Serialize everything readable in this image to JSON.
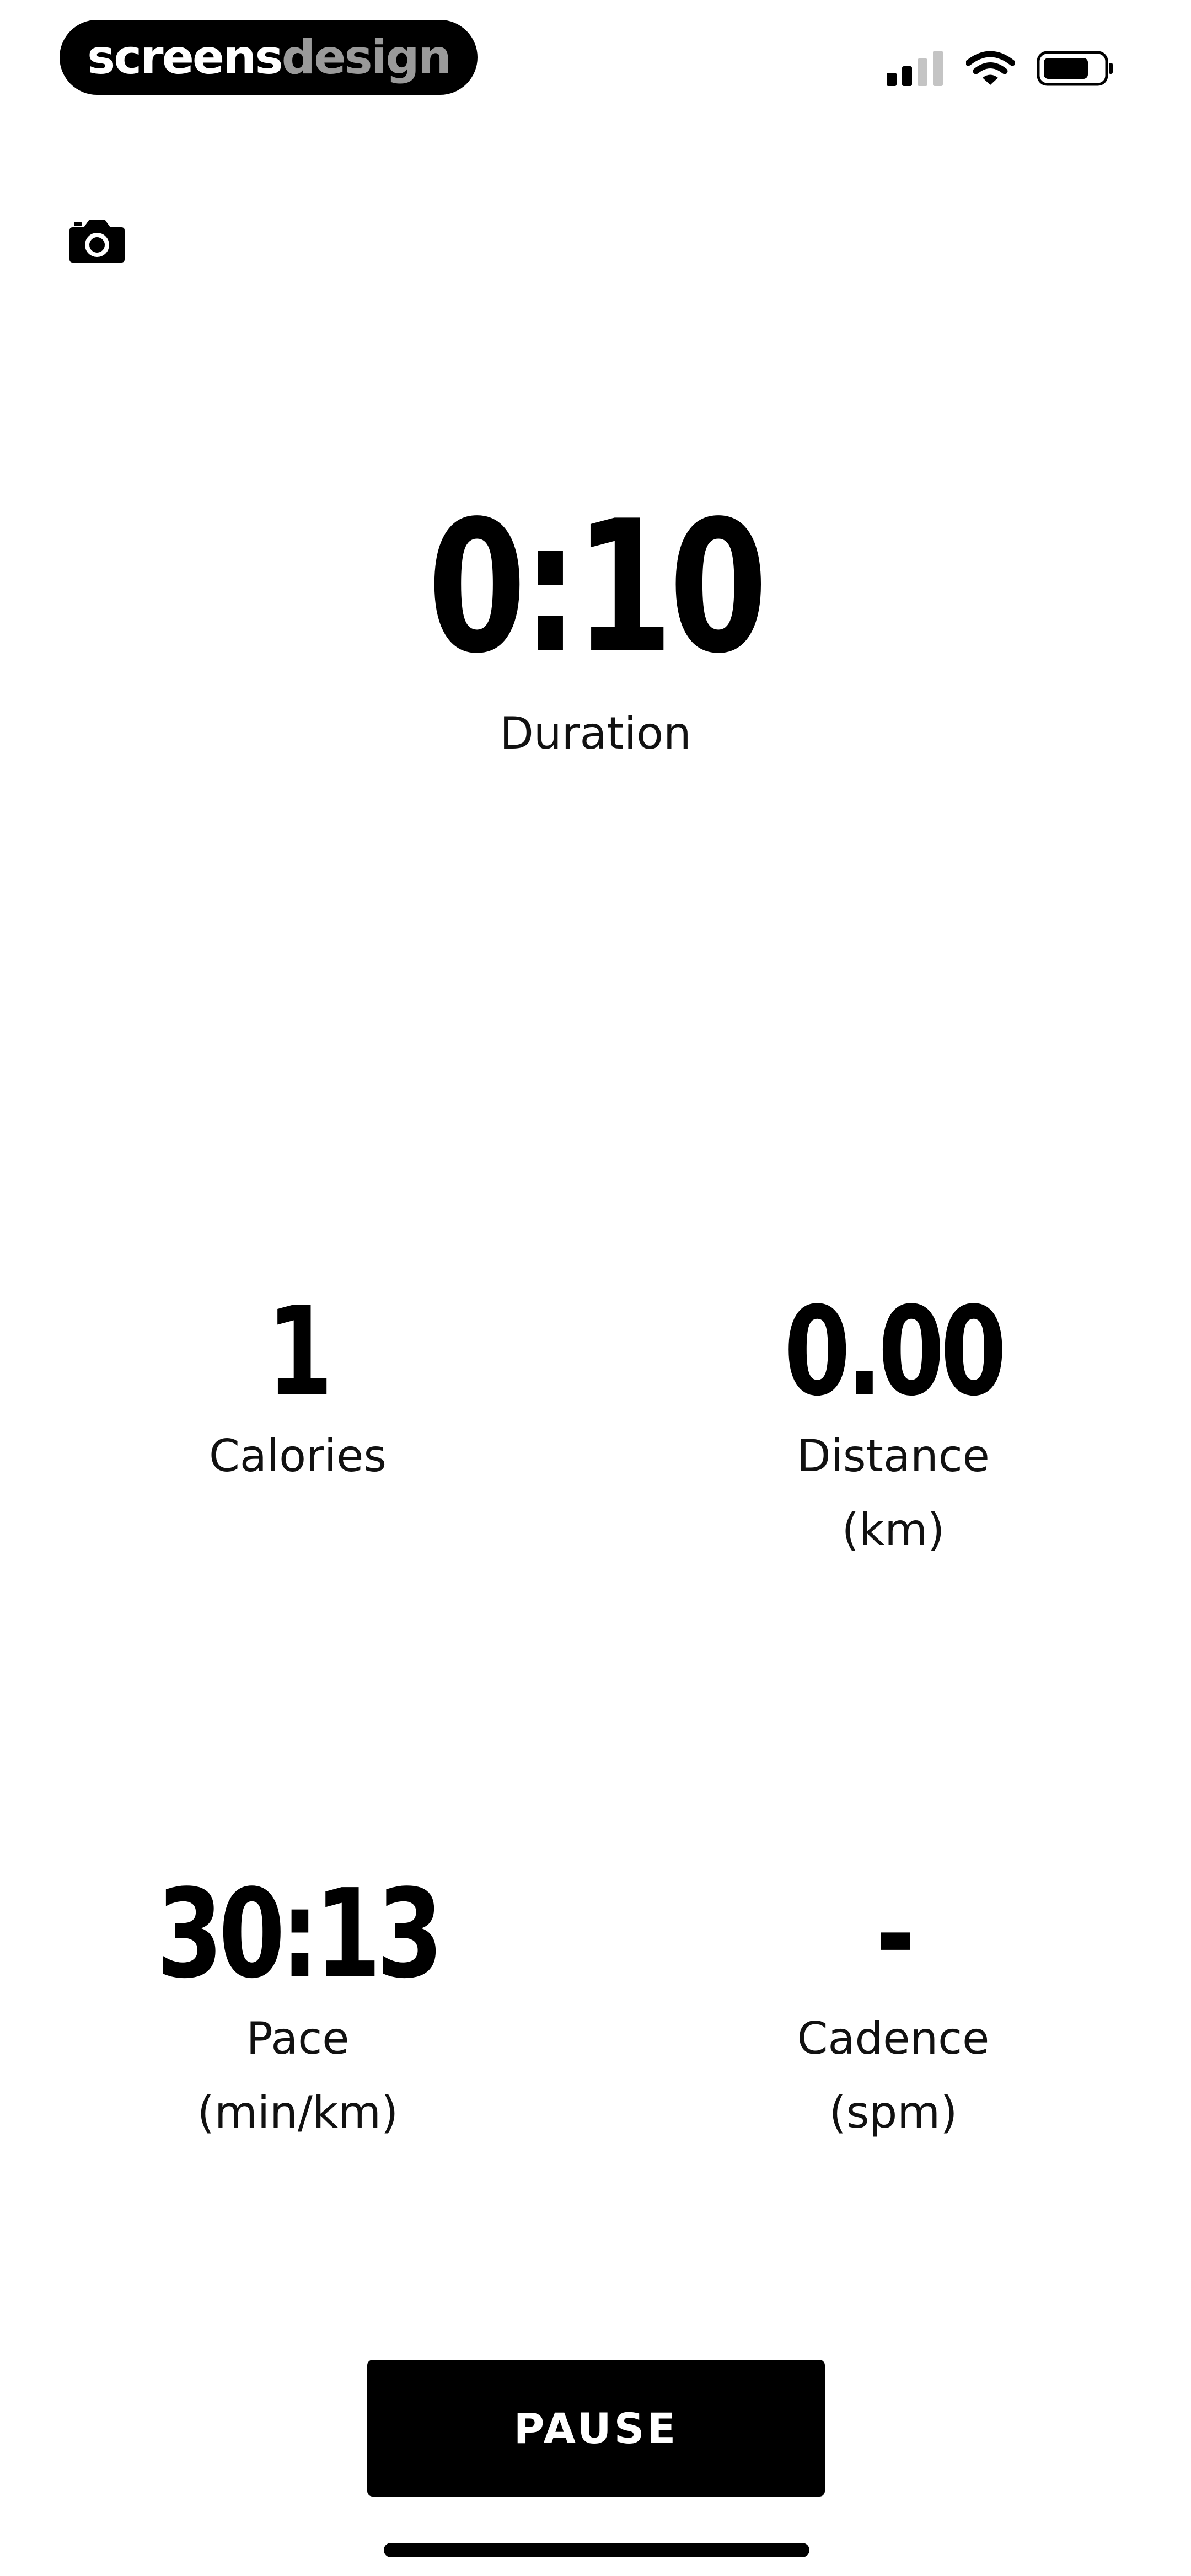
{
  "status_bar": {
    "brand_part1": "screens",
    "brand_part2": "design",
    "icons": [
      "cellular-signal-icon",
      "wifi-icon",
      "battery-icon"
    ]
  },
  "toolbar": {
    "camera_icon": "camera-icon"
  },
  "metrics": {
    "duration": {
      "value": "0:10",
      "label": "Duration"
    },
    "calories": {
      "value": "1",
      "label": "Calories"
    },
    "distance": {
      "value": "0.00",
      "label_line1": "Distance",
      "label_line2": "(km)"
    },
    "pace": {
      "value": "30:13",
      "label_line1": "Pace",
      "label_line2": "(min/km)"
    },
    "cadence": {
      "value": "-",
      "label_line1": "Cadence",
      "label_line2": "(spm)"
    }
  },
  "actions": {
    "pause_label": "PAUSE"
  },
  "colors": {
    "background": "#ffffff",
    "text": "#000000",
    "button_bg": "#000000",
    "button_text": "#ffffff",
    "brand_secondary": "#9a9a9a"
  }
}
